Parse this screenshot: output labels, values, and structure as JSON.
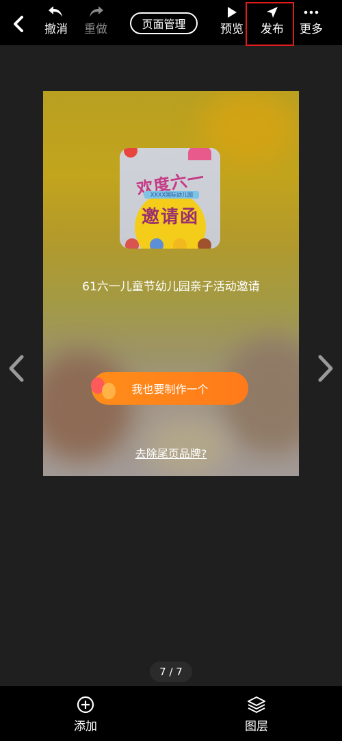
{
  "toolbar": {
    "undo_label": "撤消",
    "redo_label": "重做",
    "page_manage_label": "页面管理",
    "preview_label": "预览",
    "publish_label": "发布",
    "more_label": "更多"
  },
  "canvas": {
    "title": "61六一儿童节幼儿园亲子活动邀请",
    "thumbnail": {
      "headline": "欢度六一",
      "subline": "XXXX国际幼儿园",
      "main_text": "邀请函"
    },
    "make_button_label": "我也要制作一个",
    "remove_brand_label": "去除尾页品牌?"
  },
  "pager": {
    "text": "7 / 7"
  },
  "bottom": {
    "add_label": "添加",
    "layers_label": "图层"
  },
  "colors": {
    "toolbar_bg": "#000000",
    "workspace_bg": "#1f1f1f",
    "highlight": "#e01b1b",
    "button_orange": "#ff7f1a",
    "disabled_text": "#8a8a8a"
  },
  "icons": {
    "back": "chevron-left-icon",
    "undo": "undo-arrow-icon",
    "redo": "redo-arrow-icon",
    "preview": "play-icon",
    "publish": "send-icon",
    "more": "more-dots-icon",
    "prev": "chevron-left-icon",
    "next": "chevron-right-icon",
    "add": "plus-circle-icon",
    "layers": "layers-icon"
  }
}
